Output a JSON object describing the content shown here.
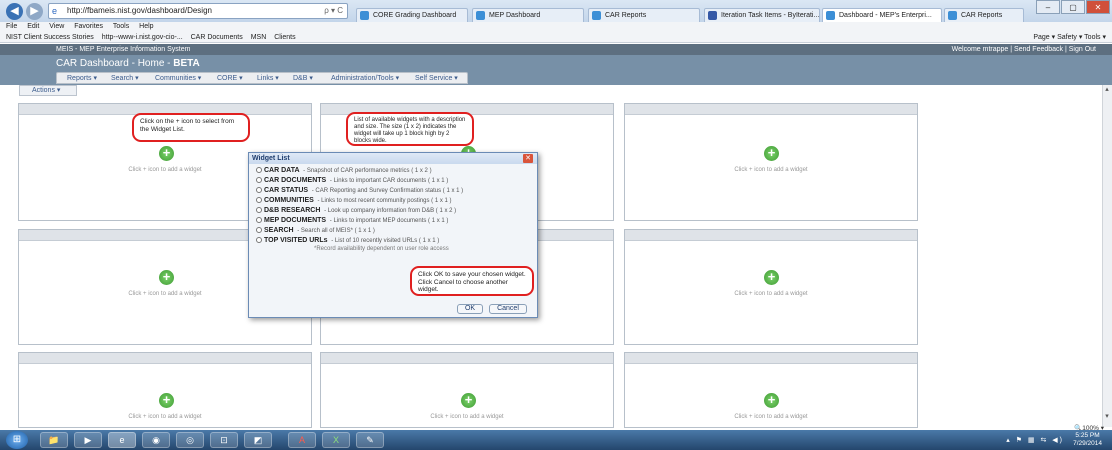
{
  "browser": {
    "url": "http://fbameis.nist.gov/dashboard/Design",
    "addr_controls": "ρ ▾ C",
    "back_symbol": "◀",
    "forward_symbol": "▶",
    "tabs": [
      {
        "label": "CORE Grading Dashboard",
        "active": false
      },
      {
        "label": "MEP Dashboard",
        "active": false
      },
      {
        "label": "CAR Reports",
        "active": false
      },
      {
        "label": "Iteration Task Items - ByIterati...",
        "active": false
      },
      {
        "label": "Dashboard - MEP's Enterpri...",
        "active": true
      },
      {
        "label": "CAR Reports",
        "active": false
      }
    ],
    "window_controls": [
      "–",
      "▢",
      "✕"
    ],
    "menu": [
      "File",
      "Edit",
      "View",
      "Favorites",
      "Tools",
      "Help"
    ],
    "favorites": [
      "NIST Client Success Stories",
      "http--www-i.nist.gov-cio-...",
      "CAR Documents",
      "MSN",
      "Clients"
    ],
    "ie_tools": "Page ▾   Safety ▾   Tools ▾"
  },
  "meis": {
    "title": "MEIS - MEP Enterprise Information System",
    "user_links": "Welcome mtrappe  |  Send Feedback  |  Sign Out"
  },
  "car": {
    "title_prefix": "CAR Dashboard - Home - ",
    "title_beta": "BETA",
    "nav": [
      "Reports ▾",
      "Search ▾",
      "Communities ▾",
      "CORE ▾",
      "Links ▾",
      "D&B ▾",
      "Administration/Tools ▾",
      "Self Service ▾"
    ],
    "actions": "Actions ▾"
  },
  "widgets": {
    "plus_symbol": "+",
    "hint": "Click + icon to add a widget"
  },
  "callouts": {
    "plus_help": "Click on the + icon to select from the Widget List.",
    "list_help": "List of available widgets with a description and size.  The size (1 x 2) indicates the widget will take up 1 block high by 2 blocks wide.",
    "ok_help": "Click OK to save your chosen widget. Click Cancel to choose another widget."
  },
  "dialog": {
    "title": "Widget List",
    "close_symbol": "✕",
    "options": [
      {
        "name": "CAR DATA",
        "desc": " - Snapshot of CAR performance metrics  ( 1 x 2 )"
      },
      {
        "name": "CAR DOCUMENTS",
        "desc": " - Links to important CAR documents ( 1 x 1 )"
      },
      {
        "name": "CAR STATUS",
        "desc": " - CAR Reporting and Survey Confirmation status ( 1 x 1 )"
      },
      {
        "name": "COMMUNITIES",
        "desc": " - Links to most recent community postings ( 1 x 1 )"
      },
      {
        "name": "D&B RESEARCH",
        "desc": " - Look up company information from D&B ( 1 x 2 )"
      },
      {
        "name": "MEP DOCUMENTS",
        "desc": " - Links to important MEP documents ( 1 x 1 )"
      },
      {
        "name": "SEARCH",
        "desc": " - Search all of MEIS* ( 1 x 1 )"
      },
      {
        "name": "TOP VISITED URLs",
        "desc": " - List of 10 recently visited URLs ( 1 x 1 )"
      }
    ],
    "footnote": "*Record availability dependent on user role access",
    "ok": "OK",
    "cancel": "Cancel"
  },
  "status": {
    "zoom": "🔍100%  ▾"
  },
  "taskbar": {
    "start_symbol": "⊞",
    "icons": [
      "📁",
      "▶",
      "e",
      "◉",
      "◎",
      "⊡",
      "◩",
      "A",
      "X",
      "✎"
    ],
    "tray": "▴ ⚑ ▦ ⇆ ◀)",
    "time": "5:25 PM",
    "date": "7/29/2014"
  }
}
